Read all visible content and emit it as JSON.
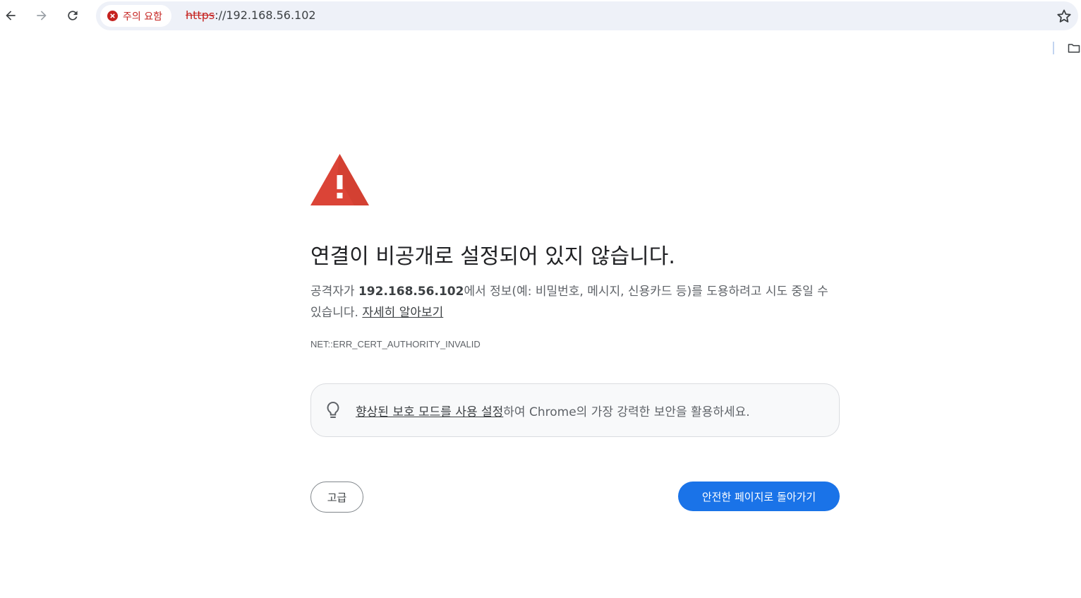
{
  "toolbar": {
    "back_icon": "arrow-left-icon",
    "forward_icon": "arrow-right-icon",
    "reload_icon": "reload-icon",
    "security_chip": {
      "icon": "error-circle-icon",
      "label": "주의 요함",
      "color": "#c5221f"
    },
    "url": {
      "scheme": "https",
      "rest": "://192.168.56.102"
    },
    "bookmark_icon": "star-icon",
    "bookmarks_folder_icon": "folder-icon"
  },
  "interstitial": {
    "icon": "warning-triangle-icon",
    "icon_color": "#db4437",
    "heading": "연결이 비공개로 설정되어 있지 않습니다.",
    "explanation": {
      "prefix": "공격자가 ",
      "host": "192.168.56.102",
      "suffix": "에서 정보(예: 비밀번호, 메시지, 신용카드 등)를 도용하려고 시도 중일 수 있습니다. ",
      "learn_more": "자세히 알아보기"
    },
    "error_code": "NET::ERR_CERT_AUTHORITY_INVALID",
    "promo": {
      "icon": "lightbulb-icon",
      "link_text": "향상된 보호 모드를 사용 설정",
      "rest_text": "하여 Chrome의 가장 강력한 보안을 활용하세요."
    },
    "buttons": {
      "advanced": "고급",
      "back_to_safety": "안전한 페이지로 돌아가기",
      "primary_color": "#1a73e8"
    }
  }
}
